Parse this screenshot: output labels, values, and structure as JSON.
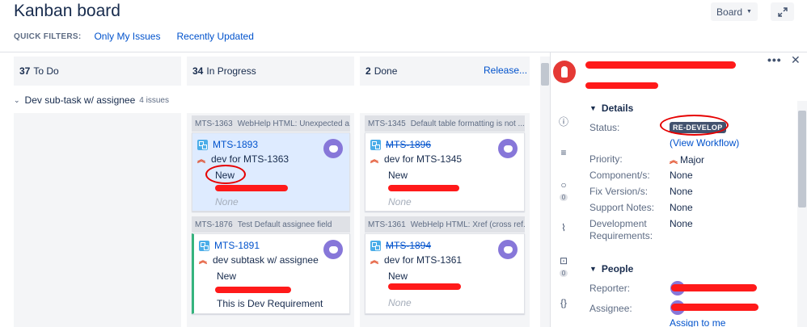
{
  "header": {
    "title": "Kanban board",
    "board_button": "Board",
    "quick_filters_label": "QUICK FILTERS:",
    "quick_filters": [
      "Only My Issues",
      "Recently Updated"
    ]
  },
  "columns": [
    {
      "count": "37",
      "name": "To Do"
    },
    {
      "count": "34",
      "name": "In Progress"
    },
    {
      "count": "2",
      "name": "Done"
    }
  ],
  "release_link": "Release...",
  "swimlane": {
    "title": "Dev sub-task w/ assignee",
    "count": "4 issues"
  },
  "cards": [
    {
      "parent_key": "MTS-1363",
      "parent_summary": "WebHelp HTML: Unexpected a...",
      "key": "MTS-1893",
      "summary": "dev for MTS-1363",
      "status": "New",
      "extra": "None"
    },
    {
      "parent_key": "MTS-1345",
      "parent_summary": "Default table formatting is not ...",
      "key": "MTS-1896",
      "summary": "dev for MTS-1345",
      "status": "New",
      "extra": "None"
    },
    {
      "parent_key": "MTS-1876",
      "parent_summary": "Test Default assignee field",
      "key": "MTS-1891",
      "summary": "dev subtask w/ assignee",
      "status": "New",
      "extra": "This is Dev Requirement"
    },
    {
      "parent_key": "MTS-1361",
      "parent_summary": "WebHelp HTML: Xref (cross ref...",
      "key": "MTS-1894",
      "summary": "dev for MTS-1361",
      "status": "New",
      "extra": "None"
    }
  ],
  "detail": {
    "details_title": "Details",
    "status_label": "Status:",
    "status_value": "RE-DEVELOP",
    "view_workflow": "(View Workflow)",
    "priority_label": "Priority:",
    "priority_value": "Major",
    "components_label": "Component/s:",
    "components_value": "None",
    "fix_label": "Fix Version/s:",
    "fix_value": "None",
    "support_label": "Support Notes:",
    "support_value": "None",
    "devreq_label": "Development Requirements:",
    "devreq_value": "None",
    "people_title": "People",
    "reporter_label": "Reporter:",
    "assignee_label": "Assignee:",
    "assign_to_me": "Assign to me",
    "rail_counts": [
      "0",
      "0"
    ]
  },
  "colors": {
    "link": "#0052cc",
    "priority": "#de350b",
    "redaction": "#ff1a1a",
    "selected_card": "#deebff",
    "lozenge": "#42526e"
  }
}
